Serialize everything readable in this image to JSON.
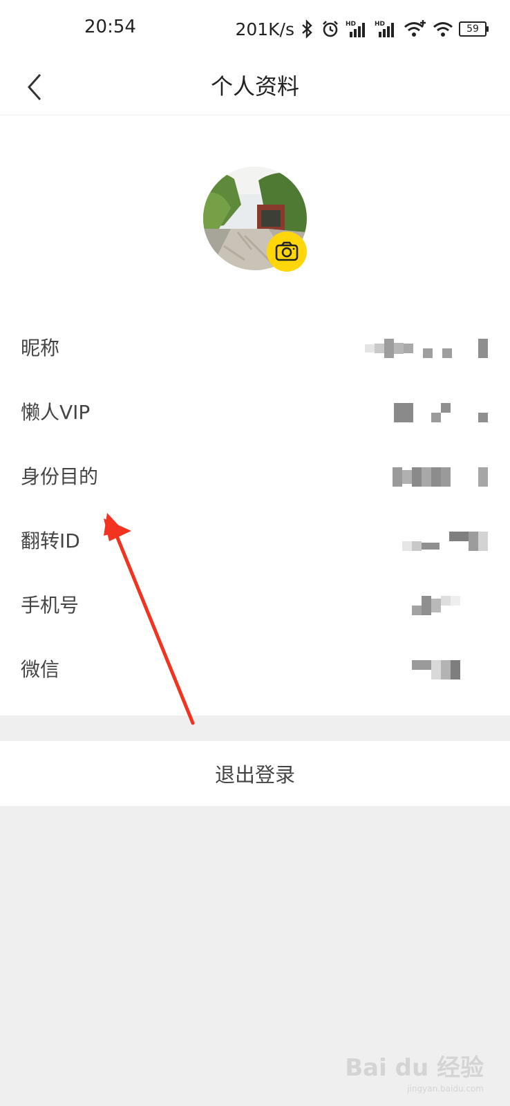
{
  "status_bar": {
    "time": "20:54",
    "network_speed": "201K/s",
    "battery": "59",
    "icons": [
      "bluetooth-icon",
      "alarm-icon",
      "signal-hd-icon",
      "signal-hd-icon",
      "wifi-plus-icon",
      "wifi-icon",
      "battery-icon"
    ]
  },
  "header": {
    "title": "个人资料",
    "back_icon": "chevron-left-icon"
  },
  "profile": {
    "camera_icon": "camera-icon",
    "badge_color": "#ffd60a",
    "rows": [
      {
        "label": "昵称"
      },
      {
        "label": "懒人VIP"
      },
      {
        "label": "身份目的"
      },
      {
        "label": "翻转ID"
      },
      {
        "label": "手机号"
      },
      {
        "label": "微信"
      }
    ]
  },
  "logout": {
    "label": "退出登录"
  },
  "annotation": {
    "color": "#f2331f"
  },
  "watermark": {
    "brand": "Bai du 经验",
    "url": "jingyan.baidu.com"
  }
}
